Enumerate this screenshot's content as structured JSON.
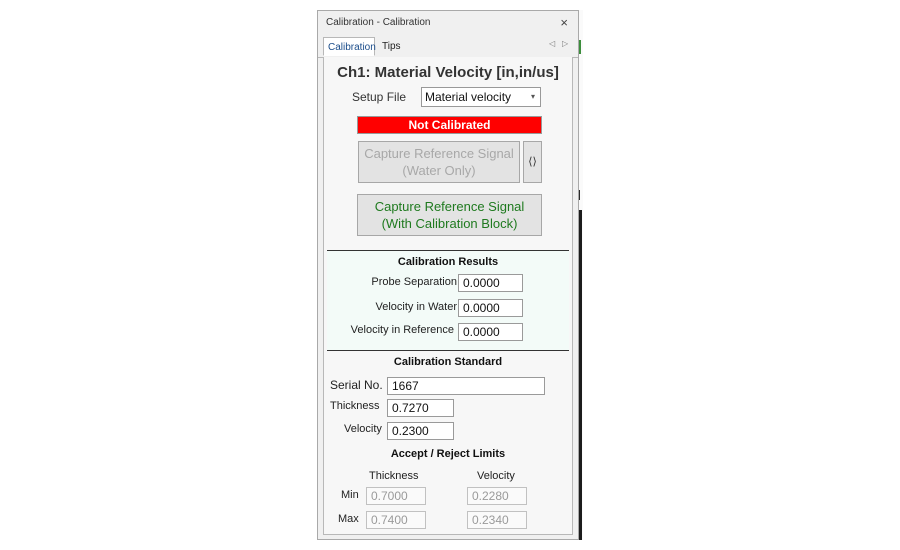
{
  "window": {
    "title": "Calibration - Calibration",
    "close_glyph": "×"
  },
  "tabs": [
    {
      "label": "Calibration",
      "active": true
    },
    {
      "label": "Tips",
      "active": false
    }
  ],
  "tab_nav": {
    "prev_glyph": "◁",
    "next_glyph": "▷"
  },
  "heading": "Ch1: Material Velocity [in,in/us]",
  "setup": {
    "label": "Setup File",
    "value": "Material velocity",
    "arrow": "▾"
  },
  "status": {
    "text": "Not Calibrated",
    "color": "#ff0000"
  },
  "buttons": {
    "capture_water_line1": "Capture Reference Signal",
    "capture_water_line2": "(Water Only)",
    "refresh_glyph": "⟨⟩",
    "capture_block_line1": "Capture Reference Signal",
    "capture_block_line2": "(With Calibration Block)"
  },
  "results": {
    "title": "Calibration Results",
    "rows": [
      {
        "label": "Probe Separation",
        "value": "0.0000"
      },
      {
        "label": "Velocity in Water",
        "value": "0.0000"
      },
      {
        "label": "Velocity in Reference",
        "value": "0.0000"
      }
    ]
  },
  "standard": {
    "title": "Calibration Standard",
    "serial_label": "Serial No.",
    "serial_value": "1667",
    "thickness_label": "Thickness",
    "thickness_value": "0.7270",
    "velocity_label": "Velocity",
    "velocity_value": "0.2300"
  },
  "limits": {
    "title": "Accept / Reject Limits",
    "col_thickness": "Thickness",
    "col_velocity": "Velocity",
    "min_label": "Min",
    "max_label": "Max",
    "min_thickness": "0.7000",
    "min_velocity": "0.2280",
    "max_thickness": "0.7400",
    "max_velocity": "0.2340"
  },
  "colors": {
    "accent_green": "#1f7a1f",
    "tab_blue": "#1a4c8a",
    "results_bg": "#f3fbf8"
  }
}
